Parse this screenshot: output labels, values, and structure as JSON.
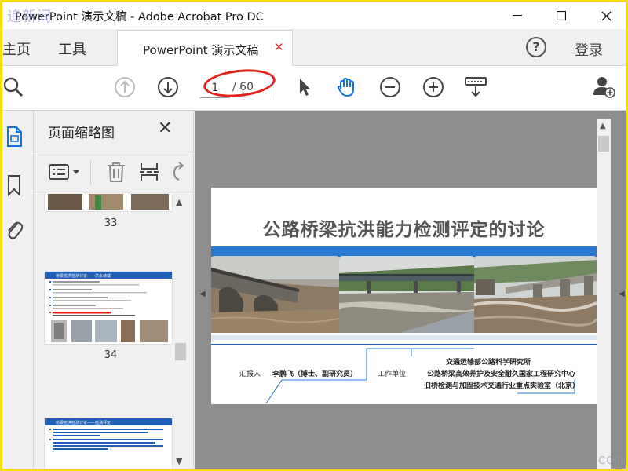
{
  "window": {
    "title": "PowerPoint 演示文稿 - Adobe Acrobat Pro DC",
    "watermark_top": "追新闻"
  },
  "tabs": {
    "home": "主页",
    "tools": "工具",
    "document": "PowerPoint 演示文稿",
    "login": "登录"
  },
  "toolbar": {
    "current_page": "1",
    "total_pages": "/ 60"
  },
  "thumbnails": {
    "panel_title": "页面缩略图",
    "pages": [
      "33",
      "34"
    ],
    "page34_title": "桥梁抗洪检测讨论——洪水荷载",
    "page35_title": "桥梁抗洪检测讨论——检测评定"
  },
  "slide": {
    "title": "公路桥梁抗洪能力检测评定的讨论",
    "reporter_label": "汇报人",
    "reporter_name": "李鹏飞（博士、副研究员）",
    "unit_label": "工作单位",
    "unit_line1": "交通运输部公路科学研究所",
    "unit_line2": "公路桥梁高效养护及安全耐久国家工程研究中心",
    "unit_line3": "旧桥检测与加固技术交通行业重点实验室（北京）"
  },
  "watermark_bottom": "com",
  "colors": {
    "accent_blue": "#2a7ad4",
    "highlight_red": "#e2231a",
    "frame_yellow": "#f4e200"
  }
}
